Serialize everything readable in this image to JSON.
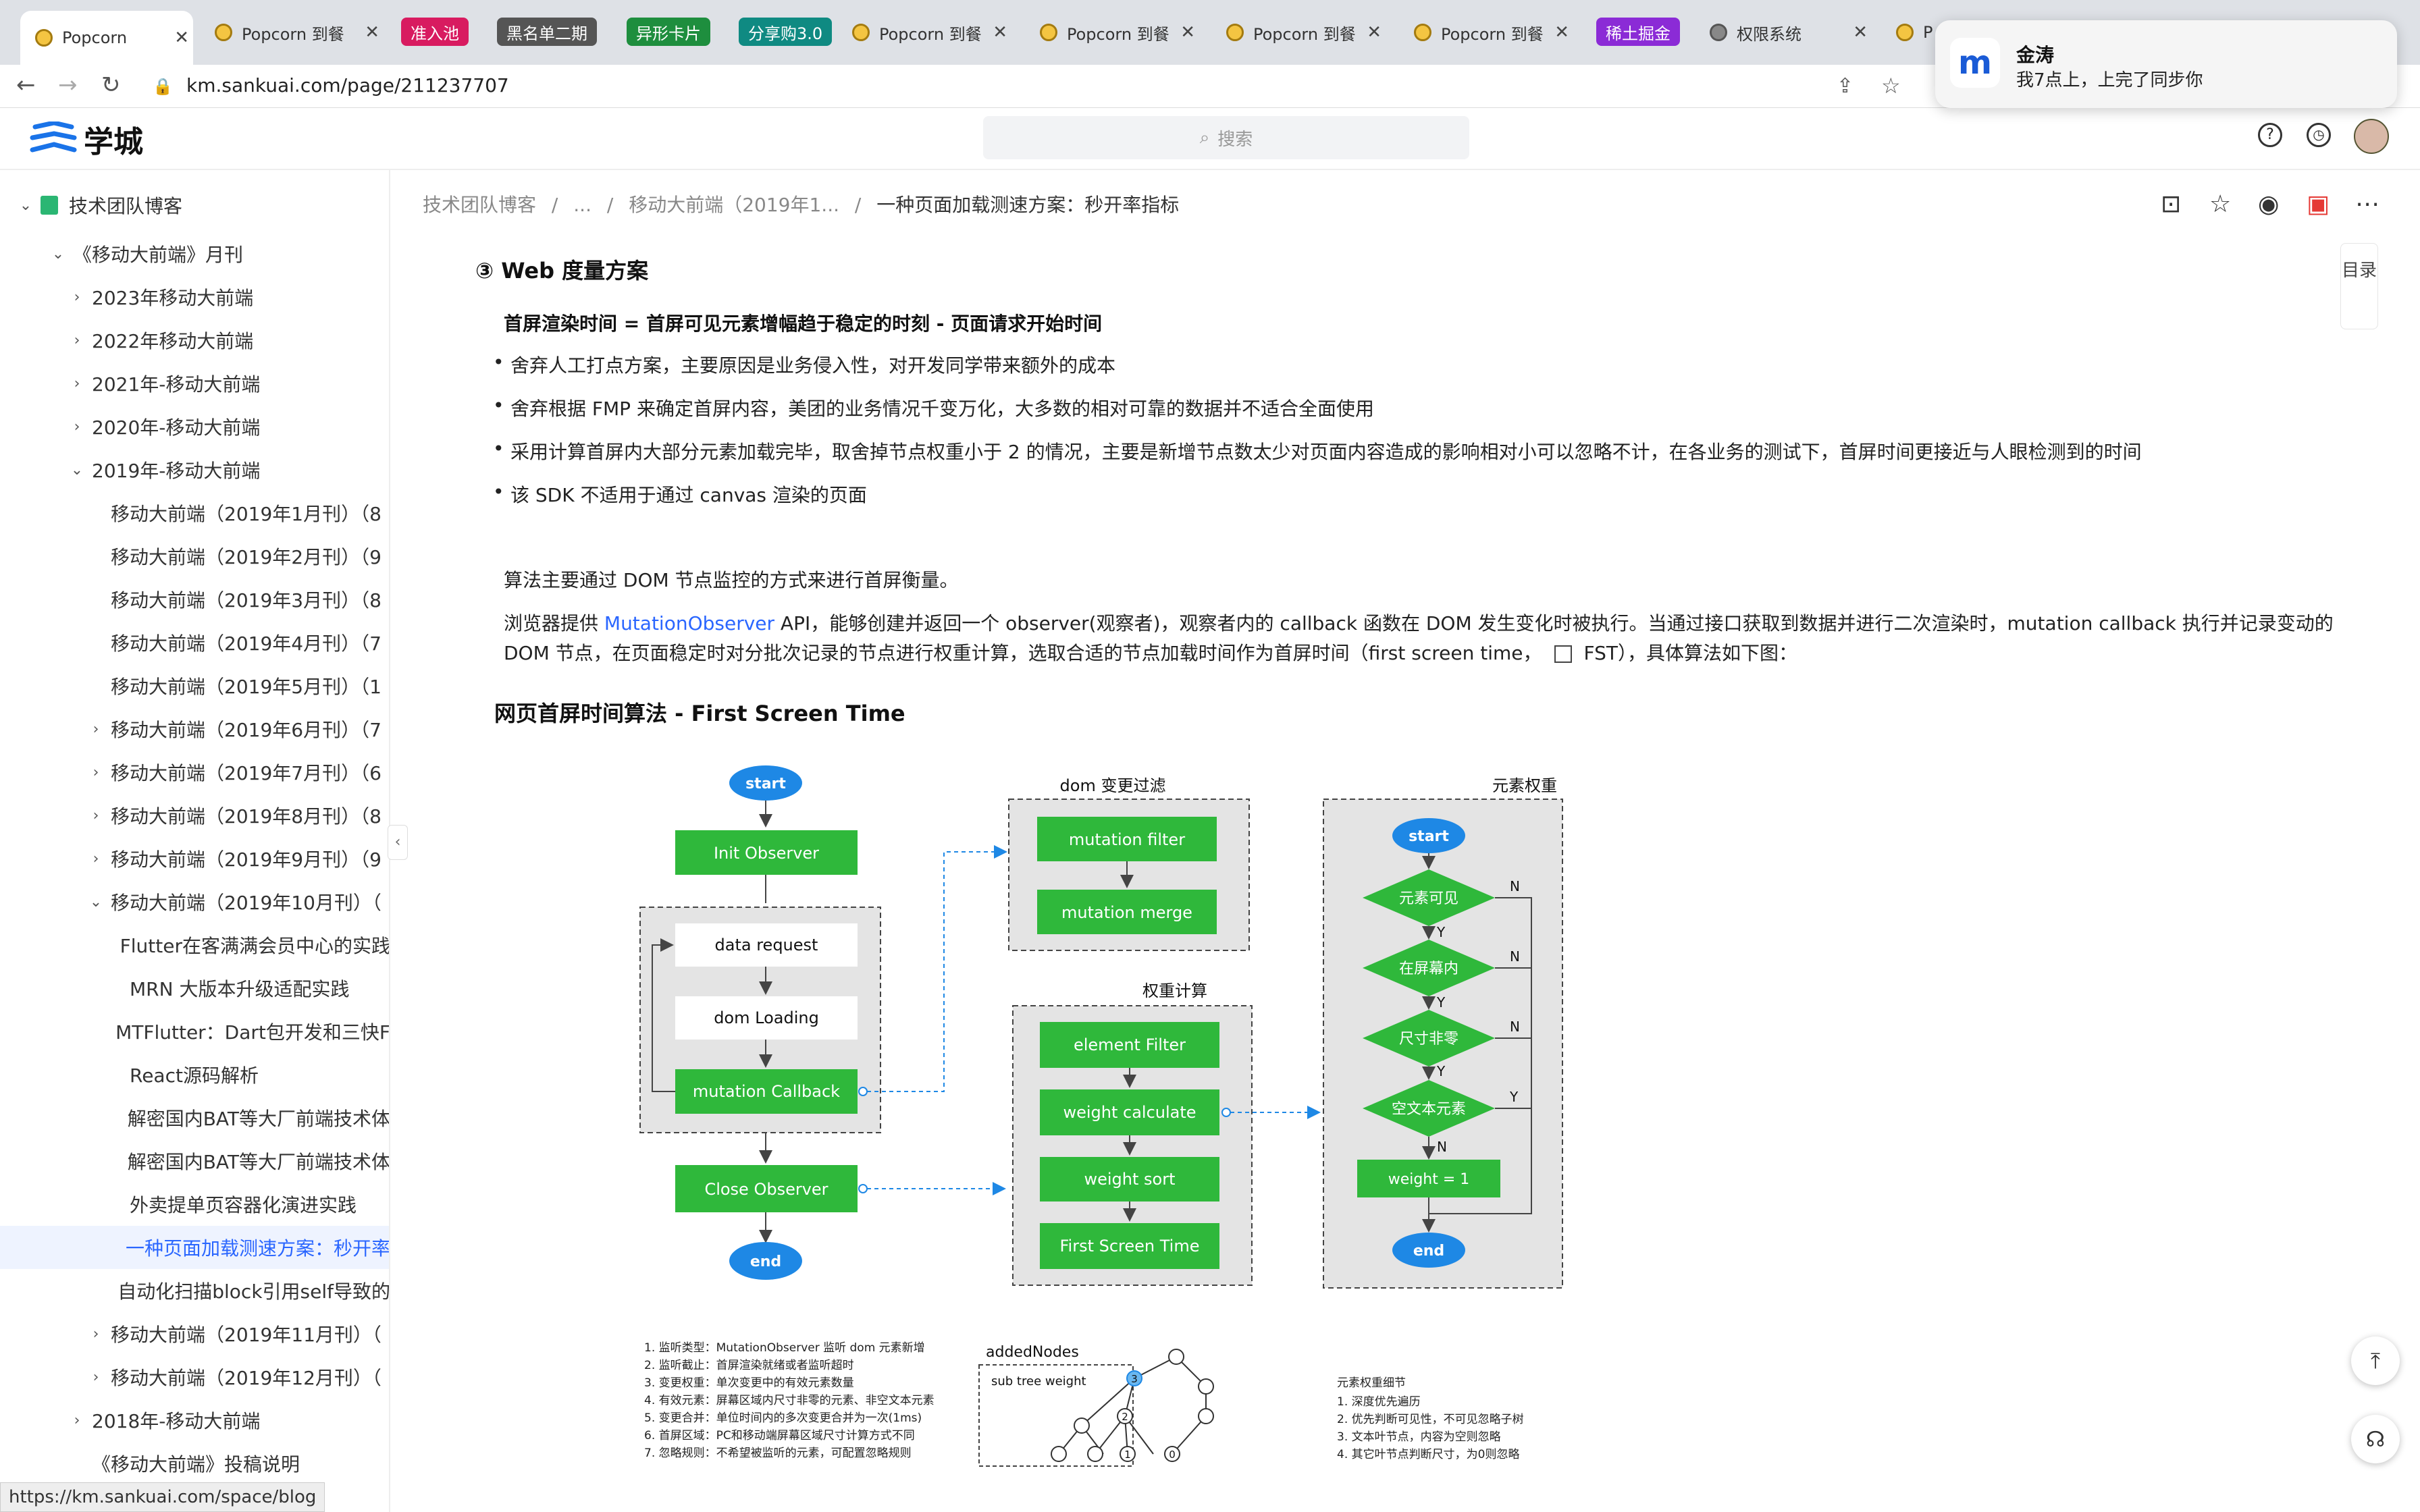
{
  "browser": {
    "tabs": [
      {
        "label": "Popcorn"
      },
      {
        "label": "Popcorn 到餐"
      },
      {
        "label": "准入池"
      },
      {
        "label": "黑名单二期"
      },
      {
        "label": "异形卡片"
      },
      {
        "label": "分享购3.0"
      },
      {
        "label": "Popcorn 到餐"
      },
      {
        "label": "Popcorn 到餐"
      },
      {
        "label": "Popcorn 到餐"
      },
      {
        "label": "Popcorn 到餐"
      },
      {
        "label": "稀土掘金"
      },
      {
        "label": "权限系统"
      },
      {
        "label": "P"
      }
    ],
    "tab_colors": [
      "#d81b60",
      "#555555",
      "#1e8e3e",
      "#0f8a82",
      "#8b2bd6"
    ],
    "url": "km.sankuai.com/page/211237707",
    "status_url": "https://km.sankuai.com/space/blog"
  },
  "notification": {
    "title": "金涛",
    "body": "我7点上，上完了同步你"
  },
  "header": {
    "logo": "学城",
    "search_placeholder": "搜索"
  },
  "sidebar": {
    "items": [
      {
        "label": "技术团队博客",
        "caret": "⌄"
      },
      {
        "label": "《移动大前端》月刊",
        "caret": "⌄"
      },
      {
        "label": "2023年移动大前端",
        "caret": "›"
      },
      {
        "label": "2022年移动大前端",
        "caret": "›"
      },
      {
        "label": "2021年-移动大前端",
        "caret": "›"
      },
      {
        "label": "2020年-移动大前端",
        "caret": "›"
      },
      {
        "label": "2019年-移动大前端",
        "caret": "⌄"
      },
      {
        "label": "移动大前端（2019年1月刊）（8",
        "caret": ""
      },
      {
        "label": "移动大前端（2019年2月刊）（9",
        "caret": ""
      },
      {
        "label": "移动大前端（2019年3月刊）（8",
        "caret": ""
      },
      {
        "label": "移动大前端（2019年4月刊）（7",
        "caret": ""
      },
      {
        "label": "移动大前端（2019年5月刊）（1",
        "caret": ""
      },
      {
        "label": "移动大前端（2019年6月刊）（7",
        "caret": "›"
      },
      {
        "label": "移动大前端（2019年7月刊）（6",
        "caret": "›"
      },
      {
        "label": "移动大前端（2019年8月刊）（8",
        "caret": "›"
      },
      {
        "label": "移动大前端（2019年9月刊）（9",
        "caret": "›"
      },
      {
        "label": "移动大前端（2019年10月刊）（",
        "caret": "⌄"
      },
      {
        "label": "Flutter在客满满会员中心的实践",
        "caret": ""
      },
      {
        "label": "MRN 大版本升级适配实践",
        "caret": ""
      },
      {
        "label": "MTFlutter：Dart包开发和三快F",
        "caret": ""
      },
      {
        "label": "React源码解析",
        "caret": ""
      },
      {
        "label": "解密国内BAT等大厂前端技术体",
        "caret": ""
      },
      {
        "label": "解密国内BAT等大厂前端技术体",
        "caret": ""
      },
      {
        "label": "外卖提单页容器化演进实践",
        "caret": ""
      },
      {
        "label": "一种页面加载测速方案：秒开率",
        "caret": ""
      },
      {
        "label": "自动化扫描block引用self导致的",
        "caret": ""
      },
      {
        "label": "移动大前端（2019年11月刊）（",
        "caret": "›"
      },
      {
        "label": "移动大前端（2019年12月刊）（",
        "caret": "›"
      },
      {
        "label": "2018年-移动大前端",
        "caret": "›"
      },
      {
        "label": "《移动大前端》投稿说明",
        "caret": ""
      }
    ]
  },
  "breadcrumb": {
    "root": "技术团队博客",
    "sep": "/",
    "ellipsis": "...",
    "parent": "移动大前端（2019年1...",
    "current": "一种页面加载测速方案：秒开率指标"
  },
  "toc_label": "目录",
  "article": {
    "heading": "③ Web 度量方案",
    "formula": "首屏渲染时间 = 首屏可见元素增幅趋于稳定的时刻 - 页面请求开始时间",
    "bullets": [
      "舍弃人工打点方案，主要原因是业务侵入性，对开发同学带来额外的成本",
      "舍弃根据 FMP 来确定首屏内容，美团的业务情况千变万化，大多数的相对可靠的数据并不适合全面使用",
      "采用计算首屏内大部分元素加载完毕，取舍掉节点权重小于 2 的情况，主要是新增节点数太少对页面内容造成的影响相对小可以忽略不计，在各业务的测试下，首屏时间更接近与人眼检测到的时间",
      "该 SDK 不适用于通过 canvas 渲染的页面"
    ],
    "para1": "算法主要通过 DOM 节点监控的方式来进行首屏衡量。",
    "para2_a": "浏览器提供 ",
    "para2_link": "MutationObserver",
    "para2_b": " API，能够创建并返回一个 observer(观察者)，观察者内的 callback 函数在 DOM 发生变化时被执行。当通过接口获取到数据并进行二次渲染时，mutation callback 执行并记录变动的",
    "para2_c": "DOM 节点，在页面稳定时对分批次记录的节点进行权重计算，选取合适的节点加载时间作为首屏时间（first screen time，",
    "para2_d": "FST），具体算法如下图：",
    "figure_title": "网页首屏时间算法 - First Screen Time"
  },
  "diagram": {
    "main": [
      "start",
      "Init Observer",
      "data request",
      "dom Loading",
      "mutation Callback",
      "Close Observer",
      "end"
    ],
    "filter_title": "dom 变更过滤",
    "filter": [
      "mutation filter",
      "mutation merge"
    ],
    "weight_title": "权重计算",
    "weight": [
      "element Filter",
      "weight calculate",
      "weight sort",
      "First Screen Time"
    ],
    "elem_title": "元素权重",
    "elem": {
      "start": "start",
      "d1": "元素可见",
      "d2": "在屏幕内",
      "d3": "尺寸非零",
      "d4": "空文本元素",
      "box": "weight = 1",
      "end": "end",
      "Y": "Y",
      "N": "N"
    },
    "notes": [
      "1.  监听类型：MutationObserver 监听 dom 元素新增",
      "2.  监听截止：首屏渲染就绪或者监听超时",
      "3.  变更权重：单次变更中的有效元素数量",
      "4.  有效元素：屏幕区域内尺寸非零的元素、非空文本元素",
      "5.  变更合并：单位时间内的多次变更合并为一次(1ms)",
      "6.  首屏区域：PC和移动端屏幕区域尺寸计算方式不同",
      "7.  忽略规则：不希望被监听的元素，可配置忽略规则"
    ],
    "tree_title": "addedNodes",
    "tree_label": "sub tree weight",
    "tree_nums": [
      "3",
      "2",
      "1",
      "0"
    ],
    "detail_title": "元素权重细节",
    "detail": [
      "1.  深度优先遍历",
      "2.  优先判断可见性，不可见忽略子树",
      "3.  文本叶节点，内容为空则忽略",
      "4.  其它叶节点判断尺寸，为0则忽略"
    ]
  }
}
